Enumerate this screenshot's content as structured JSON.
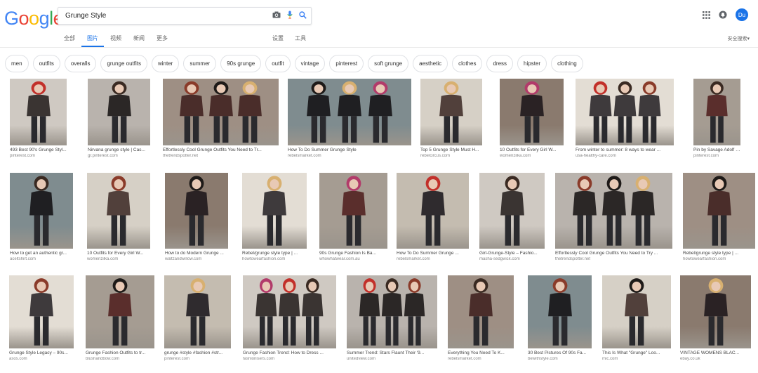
{
  "search": {
    "query": "Grunge Style"
  },
  "logo": {
    "text": "Google"
  },
  "user": {
    "initials": "Du"
  },
  "tabs": [
    "全部",
    "图片",
    "视频",
    "新闻",
    "更多"
  ],
  "tools": [
    "设置",
    "工具"
  ],
  "safesearch": "安全搜索▾",
  "chips": [
    "men",
    "outfits",
    "overalls",
    "grunge outfits",
    "winter",
    "summer",
    "90s grunge",
    "outfit",
    "vintage",
    "pinterest",
    "soft grunge",
    "aesthetic",
    "clothes",
    "dress",
    "hipster",
    "clothing"
  ],
  "rows": [
    [
      {
        "caption": "493 Best 90's Grunge Styl...",
        "source": "pinterest.com"
      },
      {
        "caption": "Nirvana grunge style | Cas...",
        "source": "gr.pinterest.com"
      },
      {
        "caption": "Effortlessly Cool Grunge Outfits You Need to Tr...",
        "source": "thetrendspotter.net"
      },
      {
        "caption": "How To Do Summer Grunge Style",
        "source": "rebelsmarket.com"
      },
      {
        "caption": "Top 5 Grunge Style Must H...",
        "source": "rebelcircus.com"
      },
      {
        "caption": "10 Outfits for Every Girl W...",
        "source": "womenzilka.com"
      },
      {
        "caption": "From winter to summer: 8 ways to wear ...",
        "source": "usa-healthy-care.com"
      },
      {
        "caption": "Pin by Savage Adolf on Gr...",
        "source": "pinterest.com"
      }
    ],
    [
      {
        "caption": "How to get an authentic gr...",
        "source": "aceltshirt.com"
      },
      {
        "caption": "10 Outfits for Every Girl W...",
        "source": "womenzilka.com"
      },
      {
        "caption": "How to do Modern Grunge ...",
        "source": "waltzandwillow.com"
      },
      {
        "caption": "Rebel/grunge style type | ...",
        "source": "howtowearfashion.com"
      },
      {
        "caption": "90s Grunge Fashion Is Ba...",
        "source": "whowhatwear.com.au"
      },
      {
        "caption": "How To Do Summer Grunge ...",
        "source": "rebelsmarket.com"
      },
      {
        "caption": "Girl-Grunge-Style – Fashio...",
        "source": "masha-sedgwick.com"
      },
      {
        "caption": "Effortlessly Cool Grunge Outfits You Need to Try ...",
        "source": "thetrendspotter.net"
      },
      {
        "caption": "Rebel/grunge style type | ...",
        "source": "howtowearfashion.com"
      }
    ],
    [
      {
        "caption": "Grunge Style Legacy – 90s...",
        "source": "asos.com"
      },
      {
        "caption": "Grunge Fashion Outfits to tr...",
        "source": "blushandbow.com"
      },
      {
        "caption": "grunge #style #fashion #str...",
        "source": "pinterest.com"
      },
      {
        "caption": "Grunge Fashion Trend: How to Dress ...",
        "source": "fashionisers.com"
      },
      {
        "caption": "Summer Trend: Stars Flaunt Their '9...",
        "source": "unitedview.com"
      },
      {
        "caption": "Everything You Need To K...",
        "source": "rebelsmarket.com"
      },
      {
        "caption": "30 Best Pictures Of 90s Fa...",
        "source": "bewithstyle.com"
      },
      {
        "caption": "This Is What \"Grunge\" Loo...",
        "source": "mic.com"
      },
      {
        "caption": "VINTAGE WOMENS BLAC...",
        "source": "ebay.co.uk"
      }
    ]
  ]
}
